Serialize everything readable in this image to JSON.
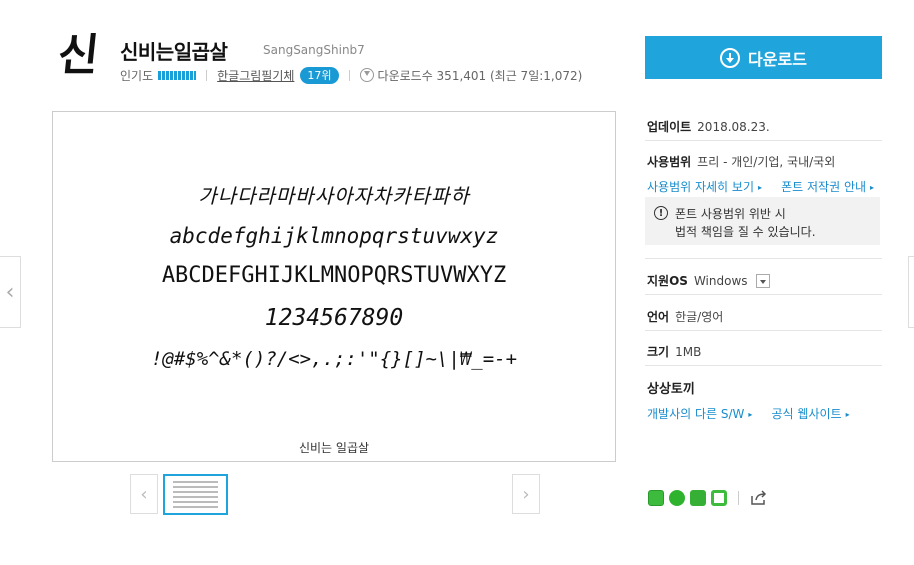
{
  "font": {
    "logo_char": "신",
    "title": "신비는일곱살",
    "maker": "SangSangShinb7",
    "popularity_label": "인기도",
    "category": "한글그림필기체",
    "rank": "17위",
    "downloads": "다운로드수 351,401 (최근 7일:1,072)"
  },
  "download_button": {
    "label": "다운로드"
  },
  "preview": {
    "lines": [
      "가나다라마바사아자차카타파하",
      "abcdefghijklmnopqrstuvwxyz",
      "ABCDEFGHIJKLMNOPQRSTUVWXYZ",
      "1234567890",
      "!@#$%^&*()?/<>,.;:'\"{}[]~\\|₩_=-+"
    ],
    "name": "신비는 일곱살",
    "prev_arrow": "‹",
    "next_arrow": "›"
  },
  "info": {
    "update_label": "업데이트",
    "update_value": "2018.08.23.",
    "usage_label": "사용범위",
    "usage_value": "프리 - 개인/기업, 국내/국외",
    "usage_detail_link": "사용범위 자세히 보기",
    "copyright_link": "폰트 저작권 안내",
    "warning_icon": "!",
    "warning_line1": "폰트 사용범위 위반 시",
    "warning_line2": "법적 책임을 질 수 있습니다.",
    "os_label": "지원OS",
    "os_value": "Windows",
    "lang_label": "언어",
    "lang_value": "한글/영어",
    "size_label": "크기",
    "size_value": "1MB",
    "vendor_title": "상상토끼",
    "vendor_sw_link": "개발사의 다른 S/W",
    "vendor_site_link": "공식 웹사이트",
    "link_arrow": "▸"
  },
  "colors": {
    "accent": "#1fa5db",
    "link": "#1a8ccc"
  },
  "icons": [
    "download-circle-icon",
    "warning-icon",
    "select-arrow-icon",
    "share-icon"
  ]
}
